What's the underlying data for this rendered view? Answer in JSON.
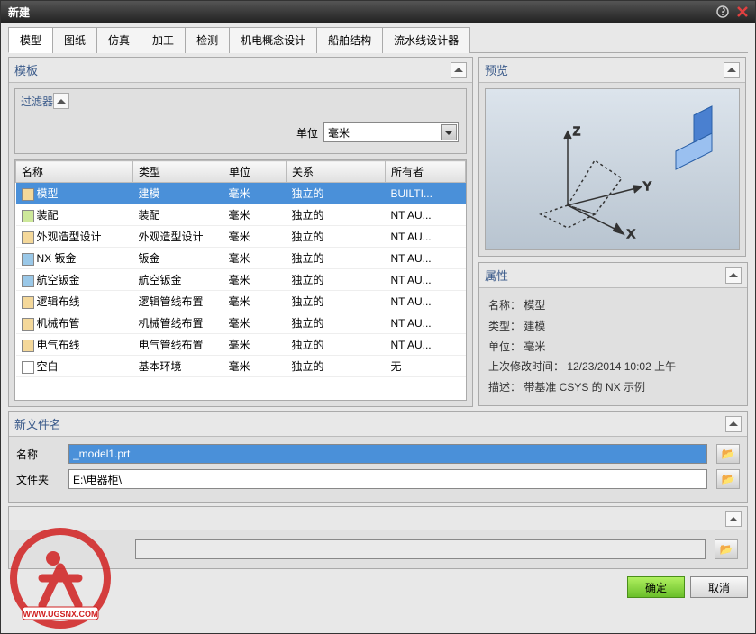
{
  "window": {
    "title": "新建"
  },
  "tabs": [
    "模型",
    "图纸",
    "仿真",
    "加工",
    "检测",
    "机电概念设计",
    "船舶结构",
    "流水线设计器"
  ],
  "activeTab": 0,
  "template": {
    "header": "模板",
    "filter": {
      "header": "过滤器",
      "unitLabel": "单位",
      "unitValue": "毫米"
    },
    "columns": [
      "名称",
      "类型",
      "单位",
      "关系",
      "所有者"
    ],
    "rows": [
      {
        "icon": "model",
        "name": "模型",
        "type": "建模",
        "unit": "毫米",
        "rel": "独立的",
        "owner": "BUILTI...",
        "selected": true
      },
      {
        "icon": "asm",
        "name": "装配",
        "type": "装配",
        "unit": "毫米",
        "rel": "独立的",
        "owner": "NT AU..."
      },
      {
        "icon": "model",
        "name": "外观造型设计",
        "type": "外观造型设计",
        "unit": "毫米",
        "rel": "独立的",
        "owner": "NT AU..."
      },
      {
        "icon": "sm",
        "name": "NX 钣金",
        "type": "钣金",
        "unit": "毫米",
        "rel": "独立的",
        "owner": "NT AU..."
      },
      {
        "icon": "sm",
        "name": "航空钣金",
        "type": "航空钣金",
        "unit": "毫米",
        "rel": "独立的",
        "owner": "NT AU..."
      },
      {
        "icon": "model",
        "name": "逻辑布线",
        "type": "逻辑管线布置",
        "unit": "毫米",
        "rel": "独立的",
        "owner": "NT AU..."
      },
      {
        "icon": "model",
        "name": "机械布管",
        "type": "机械管线布置",
        "unit": "毫米",
        "rel": "独立的",
        "owner": "NT AU..."
      },
      {
        "icon": "model",
        "name": "电气布线",
        "type": "电气管线布置",
        "unit": "毫米",
        "rel": "独立的",
        "owner": "NT AU..."
      },
      {
        "icon": "doc",
        "name": "空白",
        "type": "基本环境",
        "unit": "毫米",
        "rel": "独立的",
        "owner": "无"
      }
    ]
  },
  "preview": {
    "header": "预览"
  },
  "props": {
    "header": "属性",
    "lines": [
      "名称： 模型",
      "类型： 建模",
      "单位： 毫米",
      "上次修改时间： 12/23/2014 10:02 上午",
      "描述： 带基准 CSYS 的 NX 示例"
    ]
  },
  "newfile": {
    "header": "新文件名",
    "nameLabel": "名称",
    "nameValue": "_model1.prt",
    "folderLabel": "文件夹",
    "folderValue": "E:\\电器柜\\"
  },
  "buttons": {
    "ok": "确定",
    "cancel": "取消"
  },
  "watermark": "WWW.UGSNX.COM"
}
